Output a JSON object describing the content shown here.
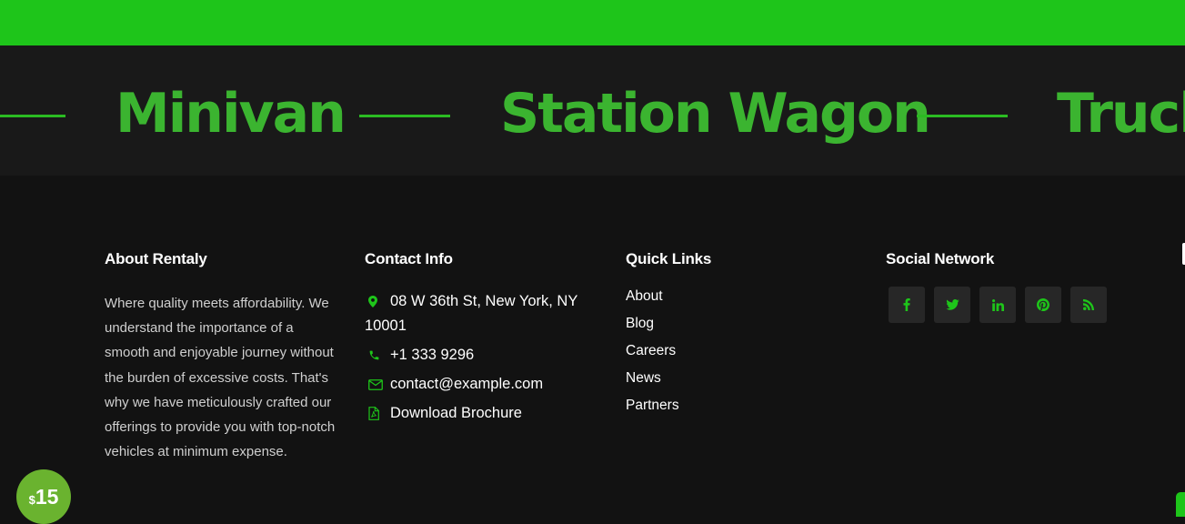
{
  "marquee": {
    "items": [
      "Minivan",
      "Station Wagon",
      "Truck"
    ]
  },
  "about": {
    "title": "About Rentaly",
    "text": "Where quality meets affordability. We understand the importance of a smooth and enjoyable journey without the burden of excessive costs. That's why we have meticulously crafted our offerings to provide you with top-notch vehicles at minimum expense."
  },
  "contact": {
    "title": "Contact Info",
    "address": "08 W 36th St, New York, NY 10001",
    "phone": "+1 333 9296",
    "email": "contact@example.com",
    "brochure": "Download Brochure"
  },
  "quick_links": {
    "title": "Quick Links",
    "items": [
      "About",
      "Blog",
      "Careers",
      "News",
      "Partners"
    ]
  },
  "social": {
    "title": "Social Network",
    "icons": [
      "facebook-icon",
      "twitter-icon",
      "linkedin-icon",
      "pinterest-icon",
      "rss-icon"
    ]
  },
  "price_badge": {
    "currency": "$",
    "amount": "15"
  },
  "colors": {
    "accent": "#1ec51a",
    "marquee_text": "#3bb430",
    "background": "#121212"
  }
}
